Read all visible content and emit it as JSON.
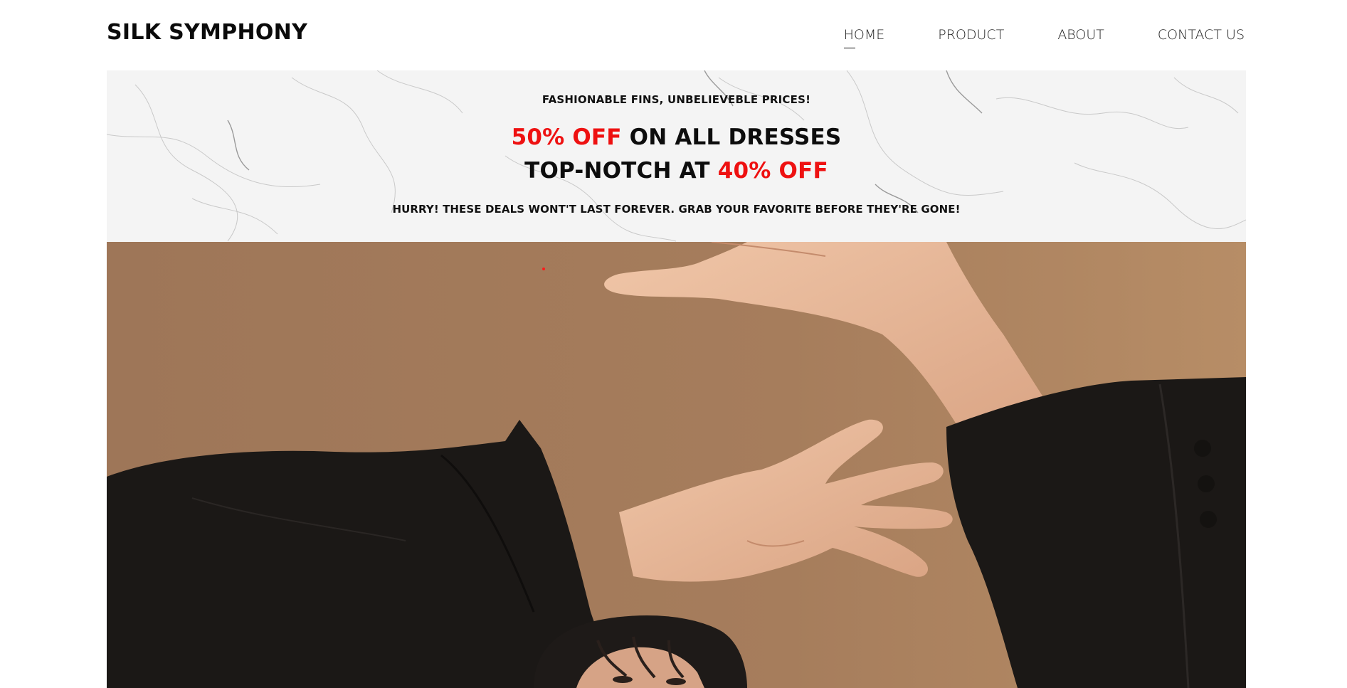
{
  "brand": {
    "name": "SILK SYMPHONY"
  },
  "nav": {
    "items": [
      {
        "label": "HOME",
        "active": true
      },
      {
        "label": "PRODUCT",
        "active": false
      },
      {
        "label": "ABOUT",
        "active": false
      },
      {
        "label": "CONTACT US",
        "active": false
      }
    ]
  },
  "promo": {
    "tagline": "FASHIONABLE FINS, UNBELIEVEBLE PRICES!",
    "line1_highlight": "50% OFF",
    "line1_rest": " ON ALL DRESSES",
    "line2_prefix": "TOP-NOTCH AT ",
    "line2_highlight": "40% OFF",
    "subline": "HURRY! THESE DEALS WONT'T LAST FOREVER. GRAB YOUR FAVORITE BEFORE THEY'RE GONE!"
  },
  "hero": {
    "image": "model-hands-framing-photo"
  },
  "colors": {
    "accent": "#ee1111",
    "hero_background": "#a27a5a",
    "jacket": "#1b1816",
    "skin": "#e6b496"
  }
}
